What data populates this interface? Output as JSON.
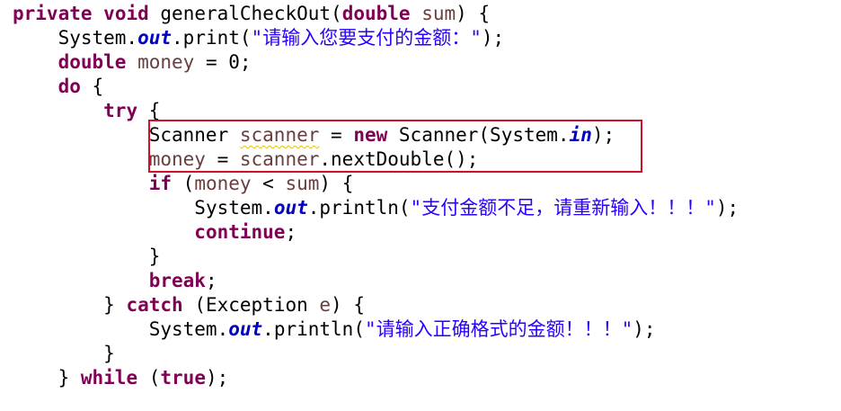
{
  "code": {
    "l1": {
      "kw_private": "private",
      "kw_void": "void",
      "method": "generalCheckOut(",
      "kw_double": "double",
      "param": "sum",
      "tail": ") {"
    },
    "l2": {
      "indent": "    ",
      "sys": "System.",
      "out": "out",
      "call": ".print(",
      "str": "\"请输入您要支付的金额：\"",
      "tail": ");"
    },
    "l3": {
      "indent": "    ",
      "kw_double": "double",
      "var": "money",
      "tail": " = 0;"
    },
    "l4": {
      "indent": "    ",
      "kw_do": "do",
      "tail": " {"
    },
    "l5": {
      "indent": "        ",
      "kw_try": "try",
      "tail": " {"
    },
    "l6": {
      "indent": "            ",
      "type": "Scanner ",
      "var": "scanner",
      "eq": " = ",
      "kw_new": "new",
      "ctor": " Scanner(System.",
      "in": "in",
      "tail": ");"
    },
    "l7": {
      "indent": "            ",
      "var1": "money",
      "eq": " = ",
      "var2": "scanner",
      "call": ".nextDouble();"
    },
    "l8": {
      "indent": "            ",
      "kw_if": "if",
      "open": " (",
      "var1": "money",
      "op": " < ",
      "var2": "sum",
      "tail": ") {"
    },
    "l9": {
      "indent": "                ",
      "sys": "System.",
      "out": "out",
      "call": ".println(",
      "str": "\"支付金额不足，请重新输入！！！\"",
      "tail": ");"
    },
    "l10": {
      "indent": "                ",
      "kw_continue": "continue",
      "tail": ";"
    },
    "l11": {
      "indent": "            ",
      "tail": "}"
    },
    "l12": {
      "indent": "            ",
      "kw_break": "break",
      "tail": ";"
    },
    "l13": {
      "indent": "        ",
      "close": "} ",
      "kw_catch": "catch",
      "mid": " (Exception ",
      "var": "e",
      "tail": ") {"
    },
    "l14": {
      "indent": "            ",
      "sys": "System.",
      "out": "out",
      "call": ".println(",
      "str": "\"请输入正确格式的金额！！！\"",
      "tail": ");"
    },
    "l15": {
      "indent": "        ",
      "tail": "}"
    },
    "l16": {
      "indent": "    ",
      "close": "} ",
      "kw_while": "while",
      "open": " (",
      "kw_true": "true",
      "tail": ");"
    }
  },
  "colors": {
    "keyword": "#7f0055",
    "local_variable": "#6a3e3e",
    "static_field": "#0000c0",
    "string": "#2a00ff",
    "highlight_box": "#d0102a",
    "warning_underline": "#e6c200"
  }
}
